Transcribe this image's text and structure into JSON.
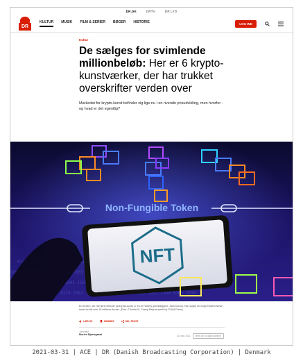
{
  "topbar": {
    "links": [
      "DR.DK",
      "DRTV",
      "DR LYD"
    ]
  },
  "logo": {
    "text": "DR"
  },
  "nav": {
    "items": [
      "KULTUR",
      "MUSIK",
      "FILM & SERIER",
      "BØGER",
      "HISTORIE"
    ],
    "login_label": "LOG IND"
  },
  "article": {
    "category": "Kultur",
    "headline_bold": "De sælges for svimlende millionbeløb:",
    "headline_rest": " Her er 6 krypto-kunstværker, der har trukket overskrifter verden over",
    "lead": "Markedet for krypto-kunst befinder sig lige nu i en rivende prisudvikling, men hvorfor - og hvad er det egentlig?",
    "hero_text": "Non-Fungible Token",
    "hero_phone_text": "NFT",
    "caption": "En af dem, der har tjent millioner på krypto-kunst, er en af Twitters grundlæggere, Jack Dorsey. Han solgte for nyligt Twitters første tweet for lidt over 18 millioner kroner. (Foto: © Andre M. Chang Reproduceret by ZUMA Press)",
    "actions": [
      "LÆS OP",
      "GEMMES",
      "DEL TEKST"
    ],
    "author": "Morten Bjørregaard",
    "role": "Journalist",
    "date": "31. mar. 2021",
    "more_label": "Mere om 30 dage gammel"
  },
  "footer_caption": "2021-03-31 | ACE | DR (Danish Broadcasting Corporation) | Denmark",
  "colors": {
    "accent": "#d81e05"
  }
}
